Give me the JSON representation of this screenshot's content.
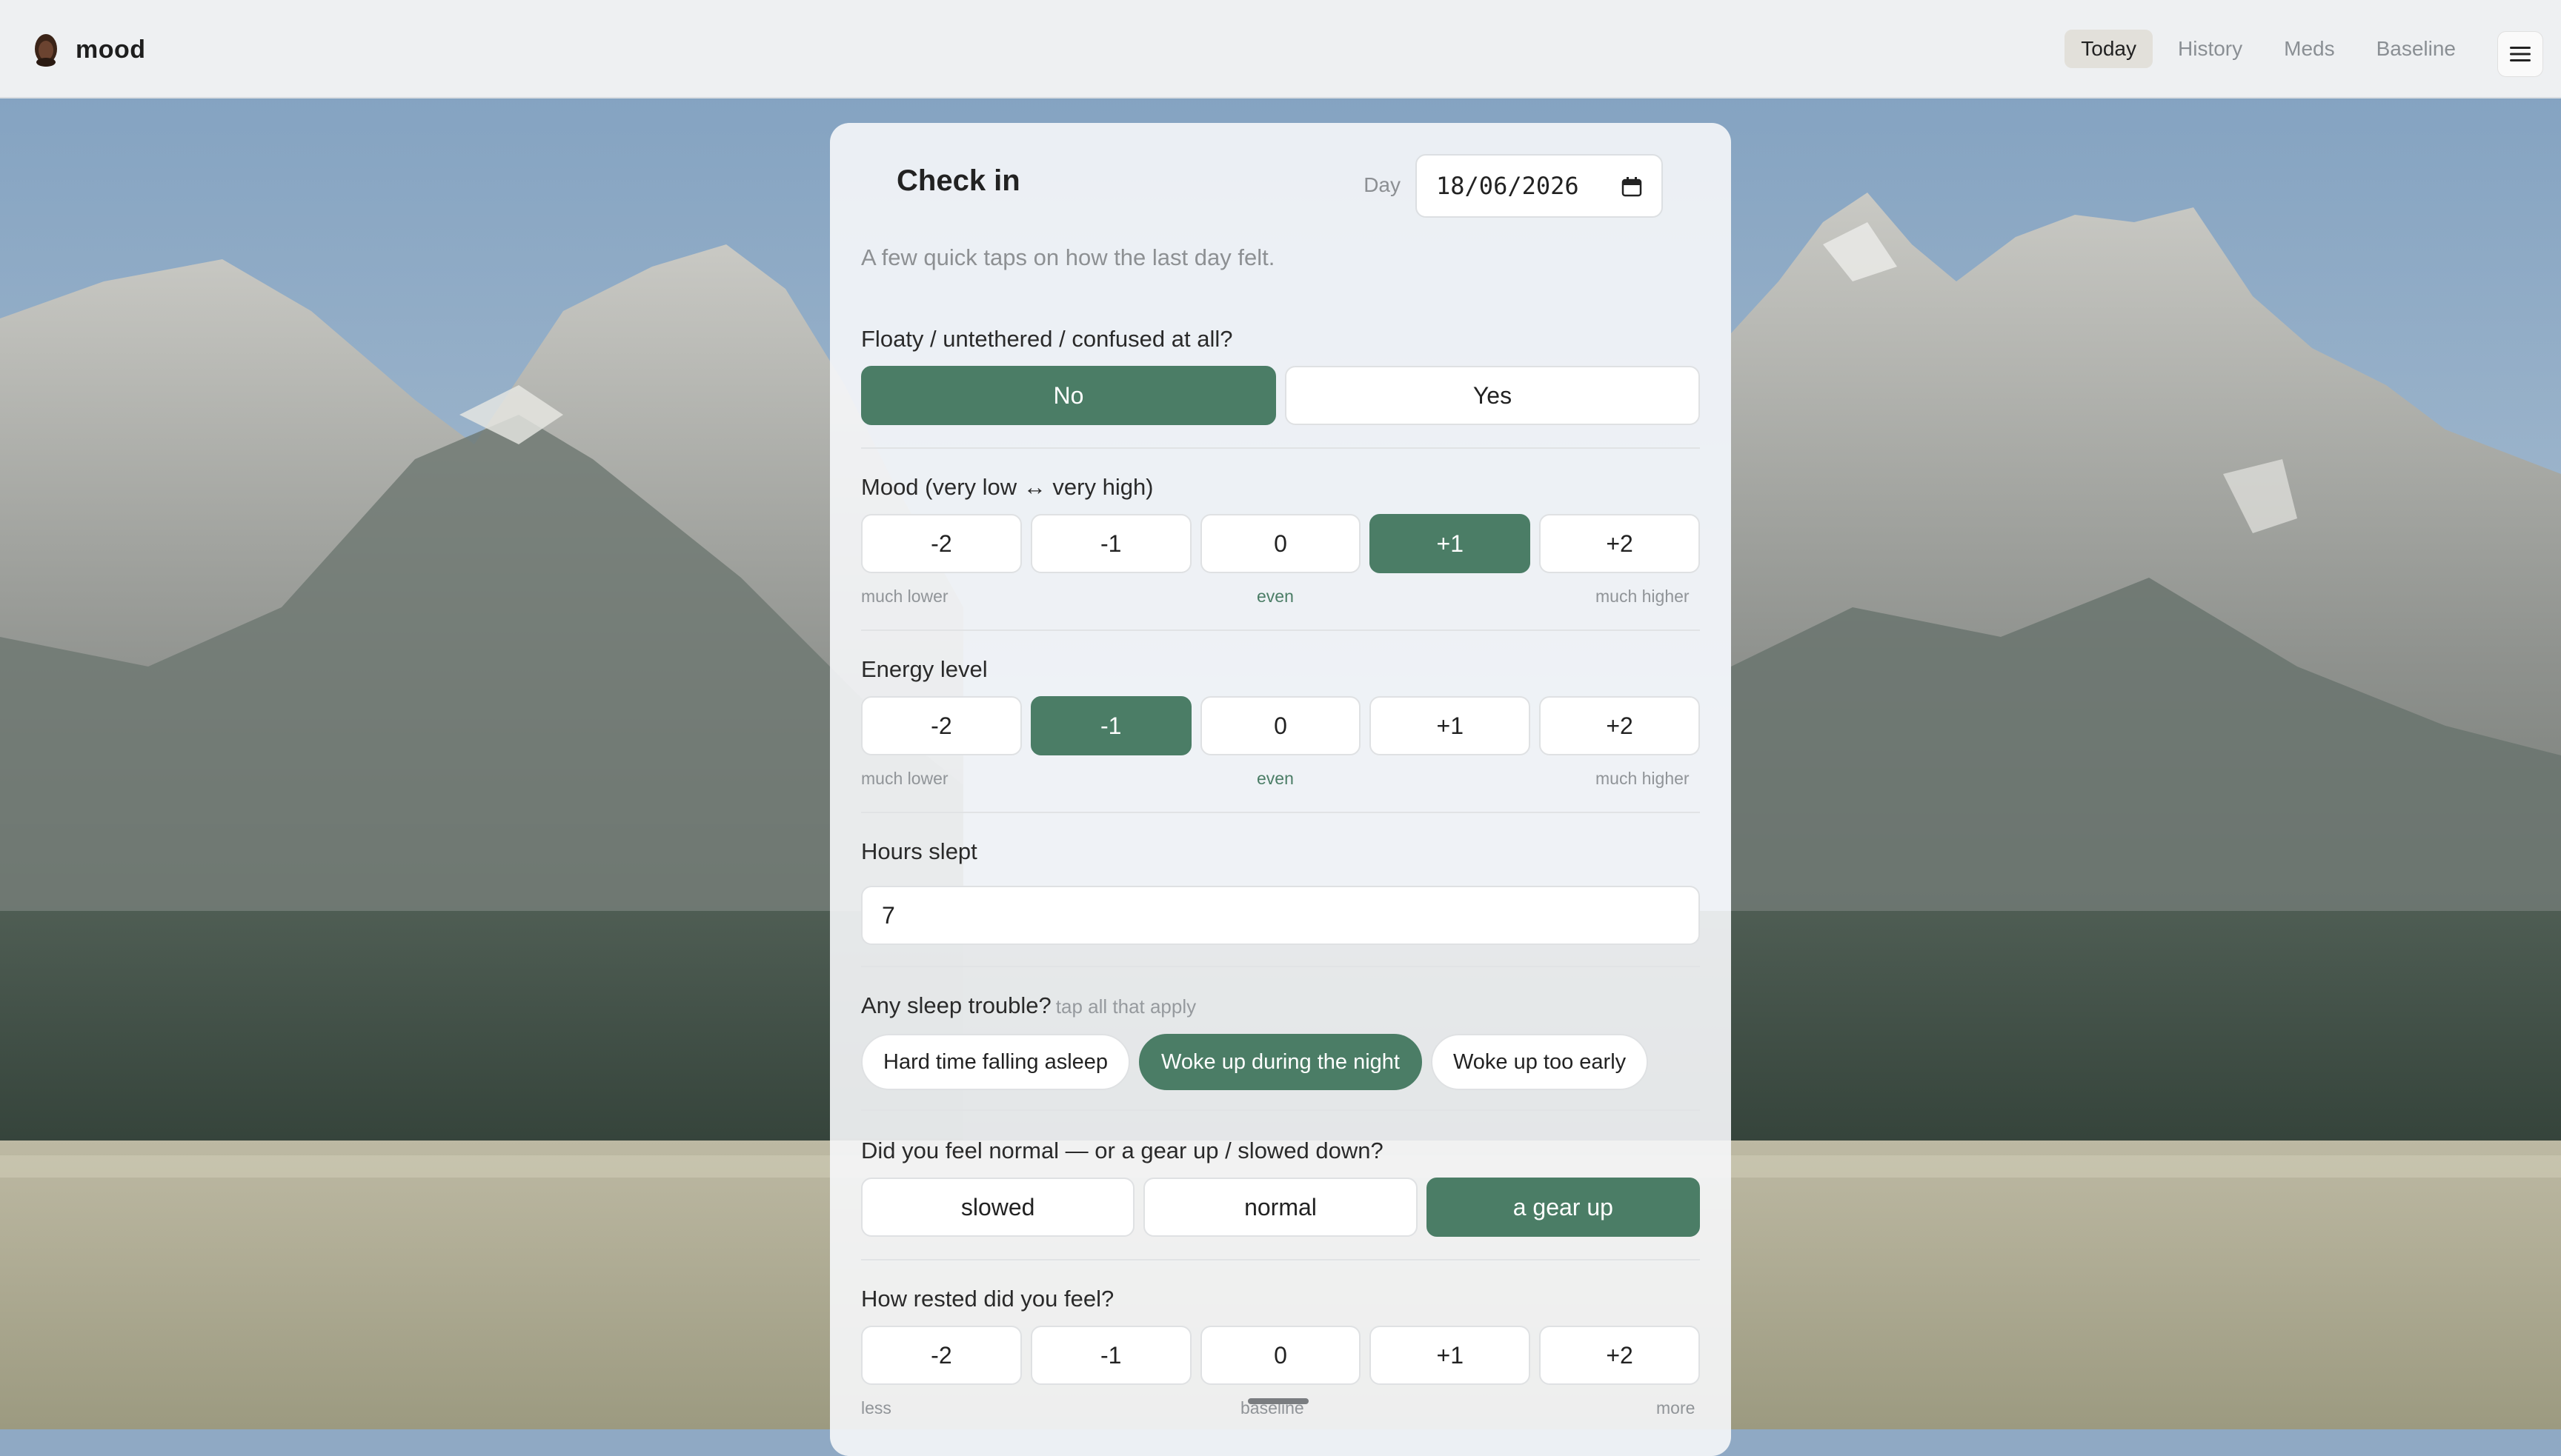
{
  "app": {
    "name": "mood"
  },
  "nav": {
    "items": [
      {
        "label": "Today",
        "active": true
      },
      {
        "label": "History",
        "active": false
      },
      {
        "label": "Meds",
        "active": false
      },
      {
        "label": "Baseline",
        "active": false
      }
    ],
    "menu_icon": "hamburger-menu-icon"
  },
  "checkin": {
    "title": "Check in",
    "day_label": "Day",
    "date_value": "18/06/2026",
    "date_icon": "calendar-icon",
    "subtitle": "A few quick taps on how the last day felt."
  },
  "questions": {
    "floaty": {
      "label": "Floaty / untethered / confused at all?",
      "options": [
        "No",
        "Yes"
      ],
      "selected": "No"
    },
    "mood": {
      "label": "Mood (very low ↔ very high)",
      "options": [
        "-2",
        "-1",
        "0",
        "+1",
        "+2"
      ],
      "selected": "+1",
      "scale_low": "much lower",
      "scale_mid": "even",
      "scale_high": "much higher"
    },
    "energy": {
      "label": "Energy level",
      "options": [
        "-2",
        "-1",
        "0",
        "+1",
        "+2"
      ],
      "selected": "-1",
      "scale_low": "much lower",
      "scale_mid": "even",
      "scale_high": "much higher"
    },
    "hours_slept": {
      "label": "Hours slept",
      "value": "7"
    },
    "sleep_trouble": {
      "label": "Any sleep trouble?",
      "hint": "tap all that apply",
      "options": [
        "Hard time falling asleep",
        "Woke up during the night",
        "Woke up too early"
      ],
      "selected": [
        "Woke up during the night"
      ]
    },
    "pace": {
      "label": "Did you feel normal — or a gear up / slowed down?",
      "options": [
        "slowed",
        "normal",
        "a gear up"
      ],
      "selected": "a gear up"
    },
    "rested": {
      "label": "How rested did you feel?",
      "options": [
        "-2",
        "-1",
        "0",
        "+1",
        "+2"
      ],
      "selected": null,
      "scale_low": "less",
      "scale_mid": "baseline",
      "scale_high": "more"
    }
  },
  "colors": {
    "accent": "#4b7d66",
    "topbar": "#eef0f2",
    "sky": "#8fa9c4"
  }
}
